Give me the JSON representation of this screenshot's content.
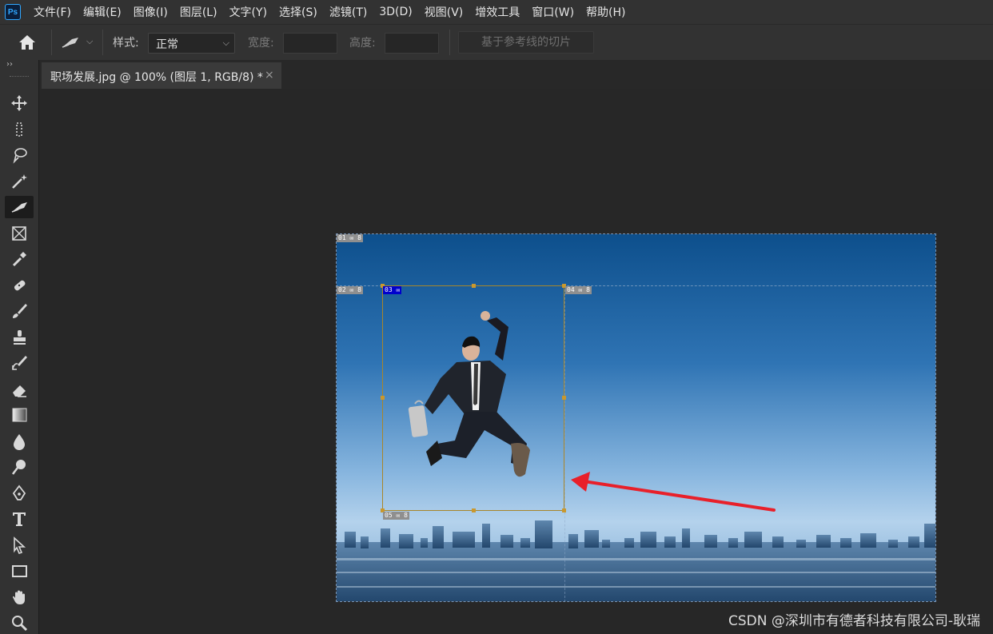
{
  "app": {
    "logo_text": "Ps"
  },
  "menu": [
    "文件(F)",
    "编辑(E)",
    "图像(I)",
    "图层(L)",
    "文字(Y)",
    "选择(S)",
    "滤镜(T)",
    "3D(D)",
    "视图(V)",
    "增效工具",
    "窗口(W)",
    "帮助(H)"
  ],
  "options": {
    "style_label": "样式:",
    "style_value": "正常",
    "width_label": "宽度:",
    "height_label": "高度:",
    "guides_button": "基于参考线的切片"
  },
  "document": {
    "tab_title": "职场发展.jpg @ 100% (图层 1, RGB/8) *",
    "close_glyph": "×"
  },
  "slices": [
    {
      "id": "01",
      "label": "01 ✉ 8",
      "selected": false
    },
    {
      "id": "02",
      "label": "02 ✉ 8",
      "selected": false
    },
    {
      "id": "03",
      "label": "03 ✉",
      "selected": true
    },
    {
      "id": "04",
      "label": "04 ✉ 8",
      "selected": false
    },
    {
      "id": "05",
      "label": "05 ✉ 8",
      "selected": false
    }
  ],
  "tools": [
    "move-tool-icon",
    "marquee-tool-icon",
    "lasso-tool-icon",
    "magic-wand-tool-icon",
    "slice-tool-icon",
    "frame-tool-icon",
    "eyedropper-tool-icon",
    "healing-brush-tool-icon",
    "brush-tool-icon",
    "clone-stamp-tool-icon",
    "history-brush-tool-icon",
    "eraser-tool-icon",
    "gradient-tool-icon",
    "blur-tool-icon",
    "dodge-tool-icon",
    "pen-tool-icon",
    "type-tool-icon",
    "path-selection-tool-icon",
    "rectangle-tool-icon",
    "hand-tool-icon",
    "zoom-tool-icon"
  ],
  "active_tool": "slice-tool-icon",
  "colors": {
    "accent": "#31a8ff",
    "slice_border": "#a8862a",
    "arrow": "#e8202a",
    "selected_badge": "#0000cc"
  },
  "watermark": "CSDN @深圳市有德者科技有限公司-耿瑞"
}
